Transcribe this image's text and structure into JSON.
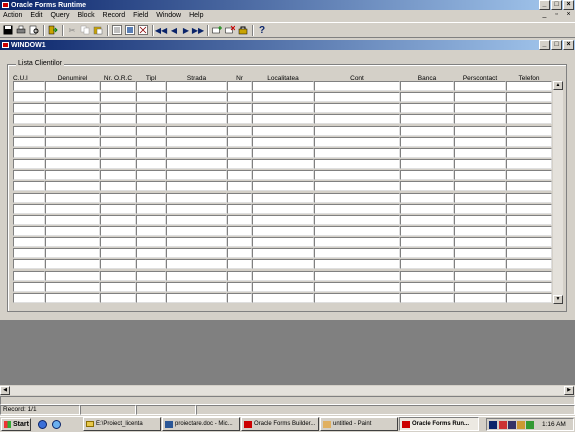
{
  "app": {
    "title": "Oracle Forms Runtime"
  },
  "menu": [
    "Action",
    "Edit",
    "Query",
    "Block",
    "Record",
    "Field",
    "Window",
    "Help"
  ],
  "toolbar": {
    "help_label": "?"
  },
  "window": {
    "title": "WINDOW1"
  },
  "frame": {
    "title": "Lista Clientilor"
  },
  "columns": [
    "C.U.I",
    "Denumirel",
    "Nr. O.R.C",
    "Tipl",
    "Strada",
    "Nr",
    "Localitatea",
    "Cont",
    "Banca",
    "Perscontact",
    "Telefon"
  ],
  "status": {
    "record": "Record: 1/1"
  },
  "taskbar": {
    "start": "Start",
    "items": [
      "E:\\Proiect_licenta",
      "proiectare.doc - Mic...",
      "Oracle Forms Builder...",
      "untitled - Paint",
      "Oracle Forms Run..."
    ],
    "clock": "1:16 AM"
  }
}
